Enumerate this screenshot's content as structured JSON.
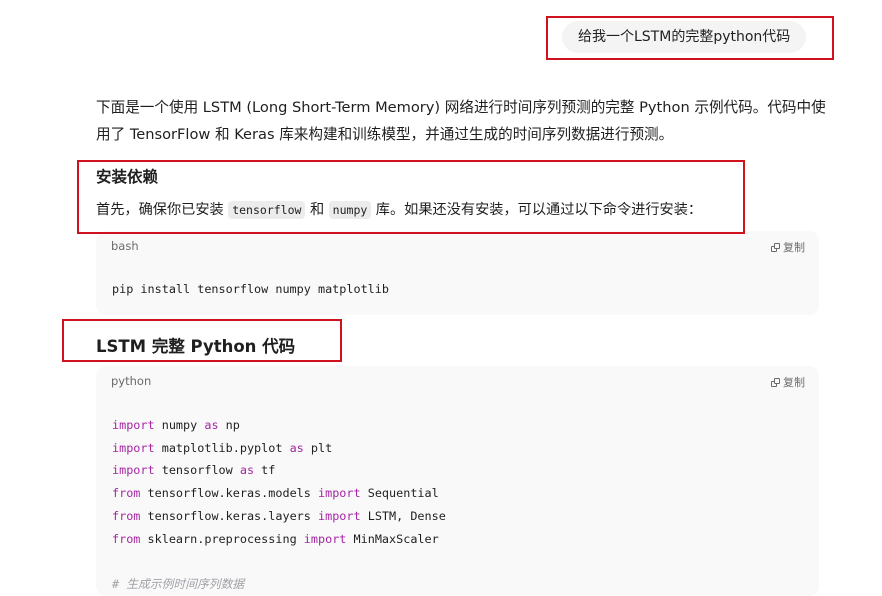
{
  "user_message": "给我一个LSTM的完整python代码",
  "intro_text": "下面是一个使用 LSTM (Long Short-Term Memory) 网络进行时间序列预测的完整 Python 示例代码。代码中使用了 TensorFlow 和 Keras 库来构建和训练模型，并通过生成的时间序列数据进行预测。",
  "install_section": {
    "heading": "安装依赖",
    "para_prefix": "首先，确保你已安装 ",
    "code1": "tensorflow",
    "para_mid": " 和 ",
    "code2": "numpy",
    "para_suffix": " 库。如果还没有安装，可以通过以下命令进行安装："
  },
  "bash_block": {
    "lang": "bash",
    "copy_label": "复制",
    "code": "pip install tensorflow numpy matplotlib"
  },
  "code_section": {
    "heading": "LSTM 完整 Python 代码"
  },
  "python_block": {
    "lang": "python",
    "copy_label": "复制",
    "lines": [
      [
        {
          "t": "import",
          "k": "kw"
        },
        {
          "t": " numpy "
        },
        {
          "t": "as",
          "k": "kw"
        },
        {
          "t": " np"
        }
      ],
      [
        {
          "t": "import",
          "k": "kw"
        },
        {
          "t": " matplotlib.pyplot "
        },
        {
          "t": "as",
          "k": "kw"
        },
        {
          "t": " plt"
        }
      ],
      [
        {
          "t": "import",
          "k": "kw"
        },
        {
          "t": " tensorflow "
        },
        {
          "t": "as",
          "k": "kw"
        },
        {
          "t": " tf"
        }
      ],
      [
        {
          "t": "from",
          "k": "kw"
        },
        {
          "t": " tensorflow.keras.models "
        },
        {
          "t": "import",
          "k": "kw"
        },
        {
          "t": " Sequential"
        }
      ],
      [
        {
          "t": "from",
          "k": "kw"
        },
        {
          "t": " tensorflow.keras.layers "
        },
        {
          "t": "import",
          "k": "kw"
        },
        {
          "t": " LSTM, Dense"
        }
      ],
      [
        {
          "t": "from",
          "k": "kw"
        },
        {
          "t": " sklearn.preprocessing "
        },
        {
          "t": "import",
          "k": "kw"
        },
        {
          "t": " MinMaxScaler"
        }
      ],
      [
        {
          "t": ""
        }
      ],
      [
        {
          "t": "# 生成示例时间序列数据",
          "k": "cm"
        }
      ]
    ]
  },
  "colors": {
    "highlight_box": "#d0121e",
    "keyword": "#a626a4",
    "comment": "#a0a1a7"
  }
}
